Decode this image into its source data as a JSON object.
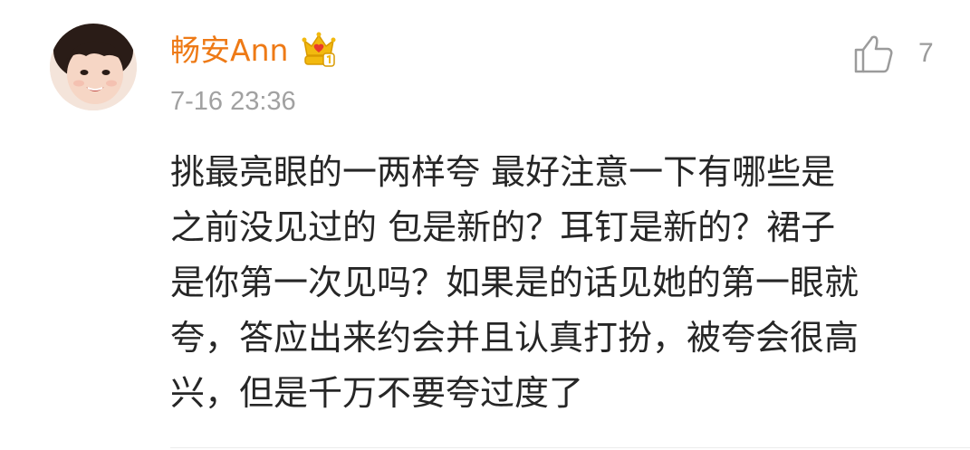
{
  "comment": {
    "username": "畅安Ann",
    "timestamp": "7-16 23:36",
    "like_count": "7",
    "lines": [
      "挑最亮眼的一两样夸 最好注意一下有哪些是",
      "之前没见过的 包是新的？耳钉是新的？裙子",
      "是你第一次见吗？如果是的话见她的第一眼就",
      "夸，答应出来约会并且认真打扮，被夸会很高",
      "兴，但是千万不要夸过度了"
    ]
  },
  "colors": {
    "username": "#ee7a16",
    "timestamp": "#a1a1a1",
    "body_text": "#262626",
    "like": "#9b9b9b",
    "vip_badge": "#f2b90f"
  },
  "icons": {
    "avatar": "user-avatar",
    "badge": "vip-crown-icon",
    "like": "thumbs-up-icon"
  }
}
